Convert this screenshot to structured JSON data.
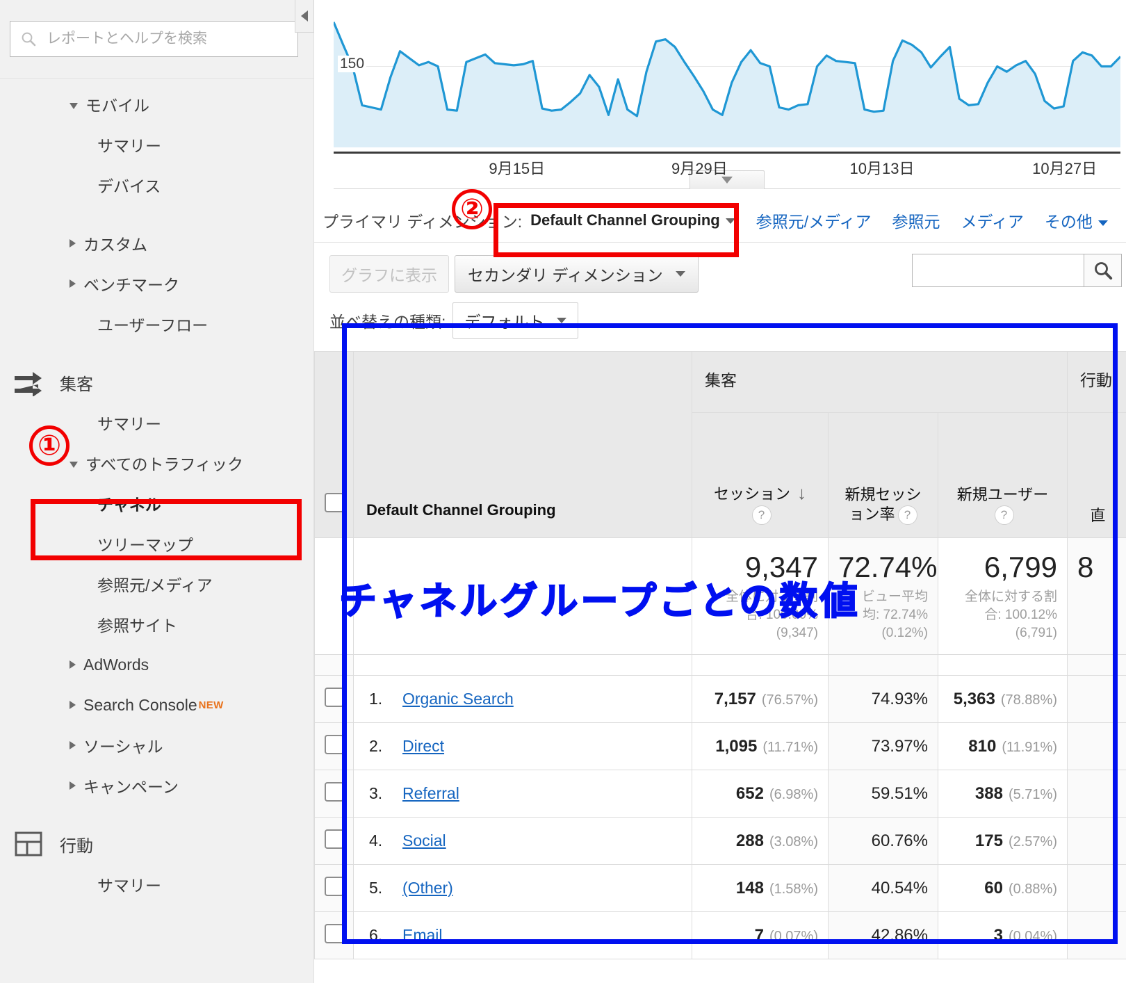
{
  "sidebar": {
    "search": {
      "placeholder": "レポートとヘルプを検索",
      "value": "",
      "icon": "search-icon"
    },
    "collapse_icon": "chevron-left-icon",
    "items": [
      {
        "label": "モバイル",
        "level": "lvl-1",
        "arrow": "open",
        "icon": ""
      },
      {
        "label": "サマリー",
        "level": "lvl-2",
        "arrow": "none",
        "icon": ""
      },
      {
        "label": "デバイス",
        "level": "lvl-2",
        "arrow": "none",
        "icon": ""
      },
      {
        "label": "",
        "level": "gap",
        "arrow": "",
        "icon": ""
      },
      {
        "label": "カスタム",
        "level": "lvl-1",
        "arrow": "closed",
        "icon": ""
      },
      {
        "label": "ベンチマーク",
        "level": "lvl-1",
        "arrow": "closed",
        "icon": ""
      },
      {
        "label": "ユーザーフロー",
        "level": "lvl-2",
        "arrow": "none",
        "icon": ""
      },
      {
        "label": "",
        "level": "gap",
        "arrow": "",
        "icon": ""
      },
      {
        "label": "集客",
        "level": "lvl-section",
        "arrow": "none",
        "icon": "acquisition-icon"
      },
      {
        "label": "サマリー",
        "level": "lvl-2",
        "arrow": "none",
        "icon": ""
      },
      {
        "label": "すべてのトラフィック",
        "level": "lvl-1",
        "arrow": "open",
        "icon": ""
      },
      {
        "label": "チャネル",
        "level": "lvl-3",
        "arrow": "none",
        "icon": "",
        "bold": true
      },
      {
        "label": "ツリーマップ",
        "level": "lvl-3",
        "arrow": "none",
        "icon": ""
      },
      {
        "label": "参照元/メディア",
        "level": "lvl-3",
        "arrow": "none",
        "icon": ""
      },
      {
        "label": "参照サイト",
        "level": "lvl-3",
        "arrow": "none",
        "icon": ""
      },
      {
        "label": "AdWords",
        "level": "lvl-1",
        "arrow": "closed",
        "icon": ""
      },
      {
        "label": "Search Console",
        "level": "lvl-1",
        "arrow": "closed",
        "icon": "",
        "badge": "NEW"
      },
      {
        "label": "ソーシャル",
        "level": "lvl-1",
        "arrow": "closed",
        "icon": ""
      },
      {
        "label": "キャンペーン",
        "level": "lvl-1",
        "arrow": "closed",
        "icon": ""
      },
      {
        "label": "",
        "level": "gap",
        "arrow": "",
        "icon": ""
      },
      {
        "label": "行動",
        "level": "lvl-section",
        "arrow": "none",
        "icon": "behavior-icon"
      },
      {
        "label": "サマリー",
        "level": "lvl-2",
        "arrow": "none",
        "icon": ""
      }
    ]
  },
  "chart_data": {
    "type": "area",
    "title": "",
    "xlabel": "",
    "ylabel": "",
    "grid": true,
    "legend_position": "none",
    "y_ticks": [
      "150"
    ],
    "ylim": [
      0,
      260
    ],
    "x_tick_labels": [
      "9月15日",
      "9月29日",
      "10月13日",
      "10月27日"
    ],
    "x_tick_positions_pct": [
      23.3,
      46.5,
      69.7,
      92.9
    ],
    "line_color": "#1f97d4",
    "fill_color": "#dceef8",
    "series": [
      {
        "name": "セッション",
        "values": [
          232,
          190,
          150,
          78,
          74,
          70,
          130,
          178,
          165,
          152,
          158,
          150,
          70,
          68,
          158,
          165,
          172,
          156,
          154,
          152,
          154,
          160,
          72,
          68,
          70,
          84,
          100,
          134,
          112,
          60,
          126,
          70,
          58,
          140,
          196,
          200,
          186,
          158,
          132,
          104,
          70,
          60,
          120,
          158,
          180,
          156,
          150,
          74,
          70,
          78,
          80,
          150,
          170,
          160,
          158,
          156,
          70,
          66,
          68,
          160,
          198,
          190,
          176,
          148,
          168,
          186,
          90,
          78,
          80,
          120,
          150,
          140,
          152,
          160,
          136,
          86,
          72,
          76,
          160,
          176,
          170,
          150,
          150,
          168
        ]
      }
    ]
  },
  "toolbar": {
    "primary_dimension_label": "プライマリ ディメンション:",
    "primary_dimension_value": "Default Channel Grouping",
    "dimension_links": [
      "参照元/メディア",
      "参照元",
      "メディア",
      "その他"
    ],
    "plot_rows_label": "グラフに表示",
    "secondary_dimension_label": "セカンダリ ディメンション",
    "sort_type_label": "並べ替えの種類:",
    "sort_type_value": "デフォルト",
    "table_search_value": "",
    "table_search_placeholder": "",
    "search_icon": "search-icon"
  },
  "table": {
    "group_headers": [
      "集客",
      "行動"
    ],
    "dimension_header": "Default Channel Grouping",
    "metric_headers": [
      "セッション",
      "新規セッション率",
      "新規ユーザー",
      "直"
    ],
    "sorted_column": "セッション",
    "sort_direction": "desc",
    "summary": {
      "sessions": "9,347",
      "sessions_sub": [
        "全体に対する割",
        "合: 100.00%",
        "(9,347)"
      ],
      "new_session_rate": "72.74%",
      "new_session_rate_sub": [
        "ビュー平均",
        "均: 72.74%",
        "(0.12%)"
      ],
      "new_users": "6,799",
      "new_users_sub": [
        "全体に対する割",
        "合: 100.12%",
        "(6,791)"
      ],
      "bounce_partial": "8"
    },
    "rows": [
      {
        "index": "1.",
        "channel": "Organic Search",
        "sessions": "7,157",
        "sessions_pct": "(76.57%)",
        "new_session_rate": "74.93%",
        "new_users": "5,363",
        "new_users_pct": "(78.88%)"
      },
      {
        "index": "2.",
        "channel": "Direct",
        "sessions": "1,095",
        "sessions_pct": "(11.71%)",
        "new_session_rate": "73.97%",
        "new_users": "810",
        "new_users_pct": "(11.91%)"
      },
      {
        "index": "3.",
        "channel": "Referral",
        "sessions": "652",
        "sessions_pct": "(6.98%)",
        "new_session_rate": "59.51%",
        "new_users": "388",
        "new_users_pct": "(5.71%)"
      },
      {
        "index": "4.",
        "channel": "Social",
        "sessions": "288",
        "sessions_pct": "(3.08%)",
        "new_session_rate": "60.76%",
        "new_users": "175",
        "new_users_pct": "(2.57%)"
      },
      {
        "index": "5.",
        "channel": "(Other)",
        "sessions": "148",
        "sessions_pct": "(1.58%)",
        "new_session_rate": "40.54%",
        "new_users": "60",
        "new_users_pct": "(0.88%)"
      },
      {
        "index": "6.",
        "channel": "Email",
        "sessions": "7",
        "sessions_pct": "(0.07%)",
        "new_session_rate": "42.86%",
        "new_users": "3",
        "new_users_pct": "(0.04%)"
      }
    ]
  },
  "annotations": {
    "marker_one": "①",
    "marker_two": "②",
    "callout_text": "チャネルグループごとの数値",
    "red": "#f20000",
    "blue": "#0010f0"
  }
}
